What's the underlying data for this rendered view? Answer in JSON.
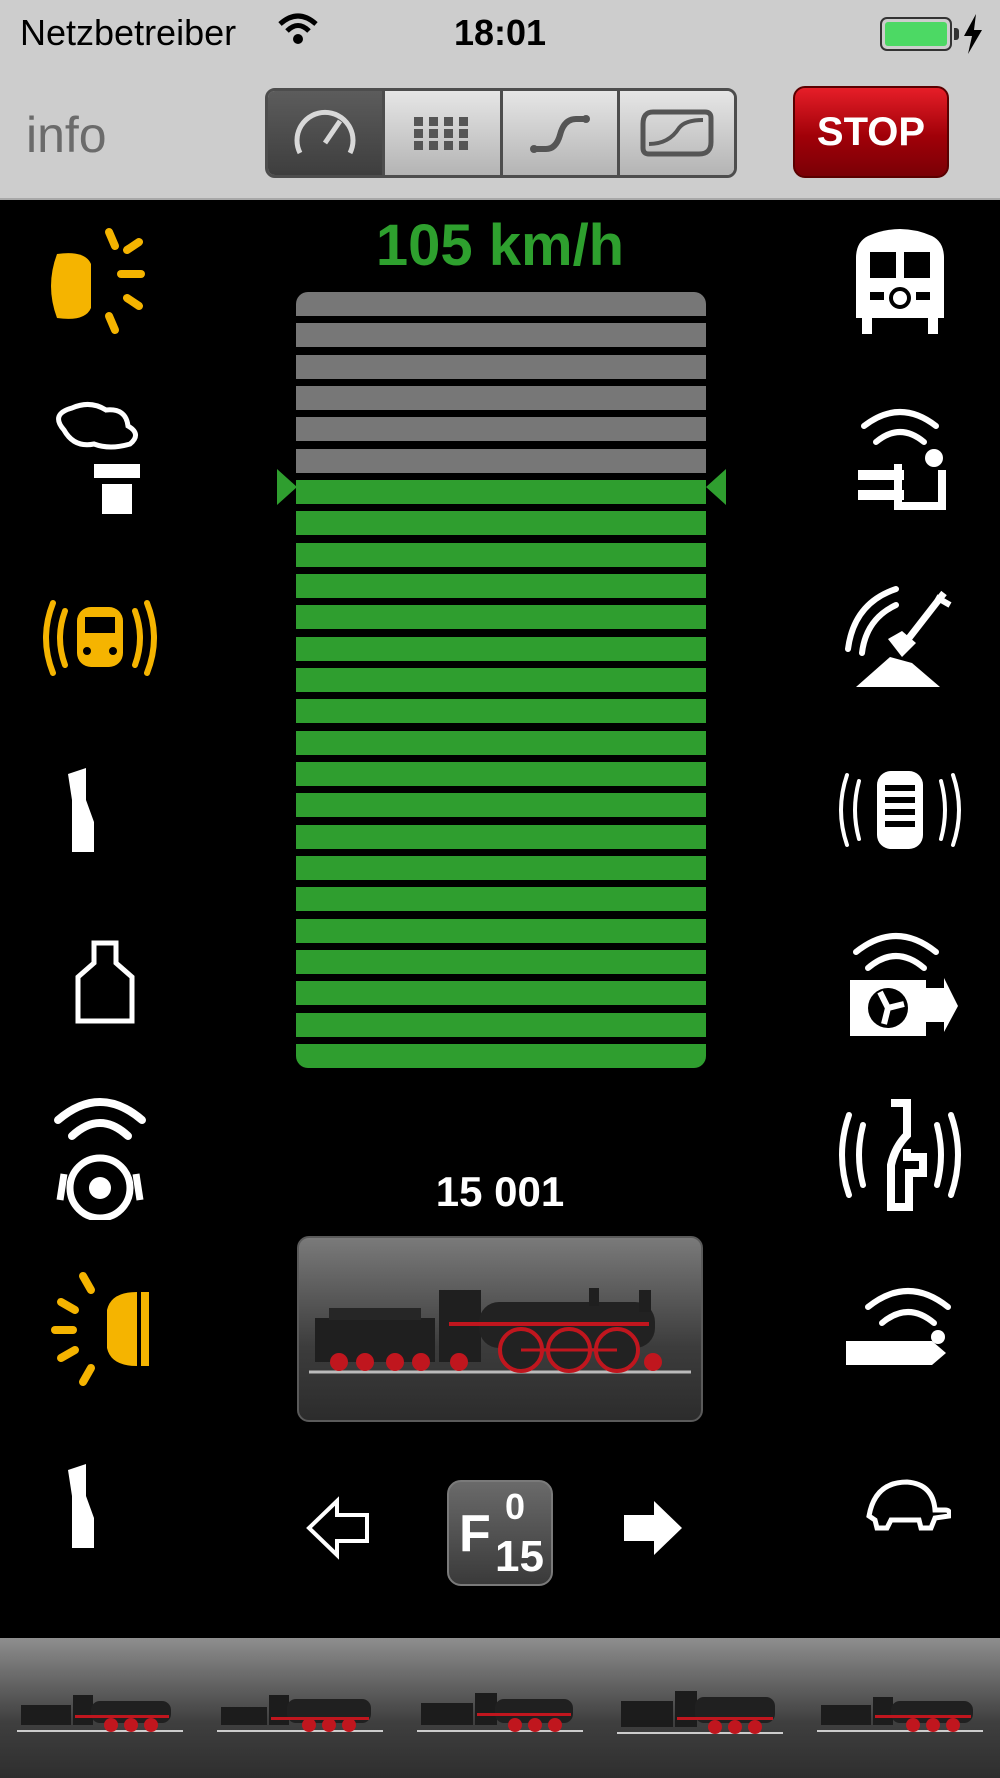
{
  "status_bar": {
    "carrier": "Netzbetreiber",
    "time": "18:01"
  },
  "toolbar": {
    "info_label": "info",
    "segments": [
      "speed-gauge-icon",
      "keyboard-grid-icon",
      "track-layout-icon",
      "layout-board-icon"
    ],
    "active_segment": 0,
    "stop_label": "STOP"
  },
  "speed": {
    "label": "105 km/h",
    "active_steps": 19,
    "total_steps": 25
  },
  "locomotive": {
    "name": "15 001"
  },
  "function_key": {
    "letter": "F",
    "range_start": "0",
    "range_end": "15"
  },
  "colors": {
    "accent_green": "#2f9e2f",
    "function_active": "#f5b400",
    "stop_red": "#c8101c"
  }
}
